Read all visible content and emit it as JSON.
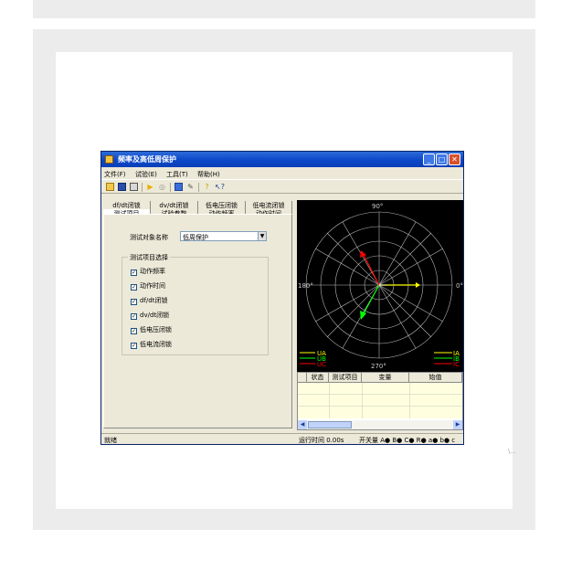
{
  "window": {
    "title": "频率及高低周保护",
    "controls": {
      "minimize": "_",
      "maximize": "□",
      "close": "✕"
    }
  },
  "menu": [
    "文件(F)",
    "试验(E)",
    "工具(T)",
    "帮助(H)"
  ],
  "toolbar": {
    "icons": [
      "open-icon",
      "save-icon",
      "print-icon",
      "play-icon",
      "stop-icon",
      "monitor-icon",
      "tool-icon",
      "help-icon",
      "context-help-icon"
    ]
  },
  "tabs": {
    "row1": [
      "df/dt闭锁",
      "dv/dt闭锁",
      "低电压闭锁",
      "低电流闭锁"
    ],
    "row2": [
      "测试项目",
      "试验参数",
      "动作频率",
      "动作时间"
    ],
    "active": "测试项目"
  },
  "form": {
    "object_label": "测试对象名称",
    "object_value": "低周保护"
  },
  "group": {
    "title": "测试项目选择",
    "items": [
      {
        "label": "动作频率",
        "checked": true
      },
      {
        "label": "动作时间",
        "checked": true
      },
      {
        "label": "df/dt闭锁",
        "checked": true
      },
      {
        "label": "dv/dt闭锁",
        "checked": true
      },
      {
        "label": "低电压闭锁",
        "checked": true
      },
      {
        "label": "低电流闭锁",
        "checked": true
      }
    ]
  },
  "scope": {
    "labels": {
      "top": "90°",
      "bottom": "270°",
      "left": "180°",
      "right": "0°"
    },
    "legend_left": [
      "UA",
      "UB",
      "UC"
    ],
    "legend_right": [
      "IA",
      "IB",
      "IC"
    ],
    "colors": {
      "UA": "#ffff00",
      "UB": "#00ff00",
      "UC": "#ff0000",
      "grid": "#b8b8b8",
      "bg": "#000000"
    }
  },
  "table": {
    "headers": [
      "状态",
      "测试项目",
      "变量",
      "始值"
    ]
  },
  "status": {
    "ready": "就绪",
    "runtime": "运行时间 0.00s",
    "switch": "开关量 A● B● C● R● a● b● c"
  },
  "watermark": "\\..."
}
